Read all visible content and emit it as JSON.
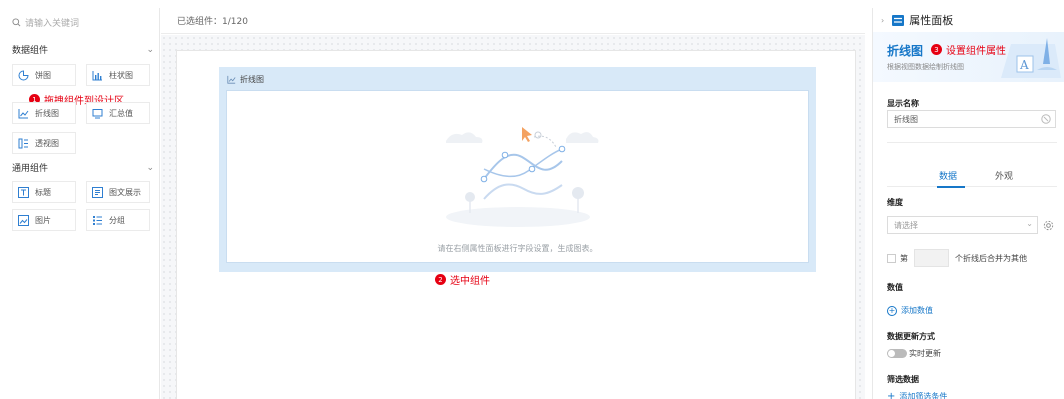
{
  "sidebar": {
    "search_placeholder": "请输入关键词",
    "sections": [
      {
        "title": "数据组件",
        "items": [
          {
            "label": "饼图",
            "icon": "pie-chart-icon"
          },
          {
            "label": "柱状图",
            "icon": "bar-chart-icon"
          },
          {
            "label": "折线图",
            "icon": "line-chart-icon"
          },
          {
            "label": "汇总值",
            "icon": "summary-icon"
          },
          {
            "label": "透视图",
            "icon": "pivot-icon"
          }
        ]
      },
      {
        "title": "通用组件",
        "items": [
          {
            "label": "标题",
            "icon": "title-icon"
          },
          {
            "label": "图文展示",
            "icon": "image-text-icon"
          },
          {
            "label": "图片",
            "icon": "image-icon"
          },
          {
            "label": "分组",
            "icon": "group-icon"
          }
        ]
      }
    ],
    "annotation": {
      "num": "1",
      "text": "拖拽组件到设计区"
    }
  },
  "center": {
    "selected": "已选组件：1/120",
    "chart_component": {
      "title": "折线图",
      "hint": "请在右侧属性面板进行字段设置，生成图表。"
    },
    "annotation": {
      "num": "2",
      "text": "选中组件"
    }
  },
  "panel": {
    "title": "属性面板",
    "banner_title": "折线图",
    "banner_subtitle": "根据视图数据绘制折线图",
    "annotation": {
      "num": "3",
      "text": "设置组件属性"
    },
    "display_name_label": "显示名称",
    "display_name_value": "折线图",
    "tabs": [
      "数据",
      "外观"
    ],
    "dimension_label": "维度",
    "dimension_placeholder": "请选择",
    "nth_prefix": "第",
    "nth_suffix": "个折线后合并为其他",
    "values_label": "数值",
    "add_value": "添加数值",
    "update_label": "数据更新方式",
    "update_toggle": "实时更新",
    "filter_label": "筛选数据",
    "add_filter": "添加筛选条件"
  },
  "colors": {
    "accent": "#1677c8",
    "annotation": "#e60012",
    "selected_bg": "#d8e9f8"
  }
}
